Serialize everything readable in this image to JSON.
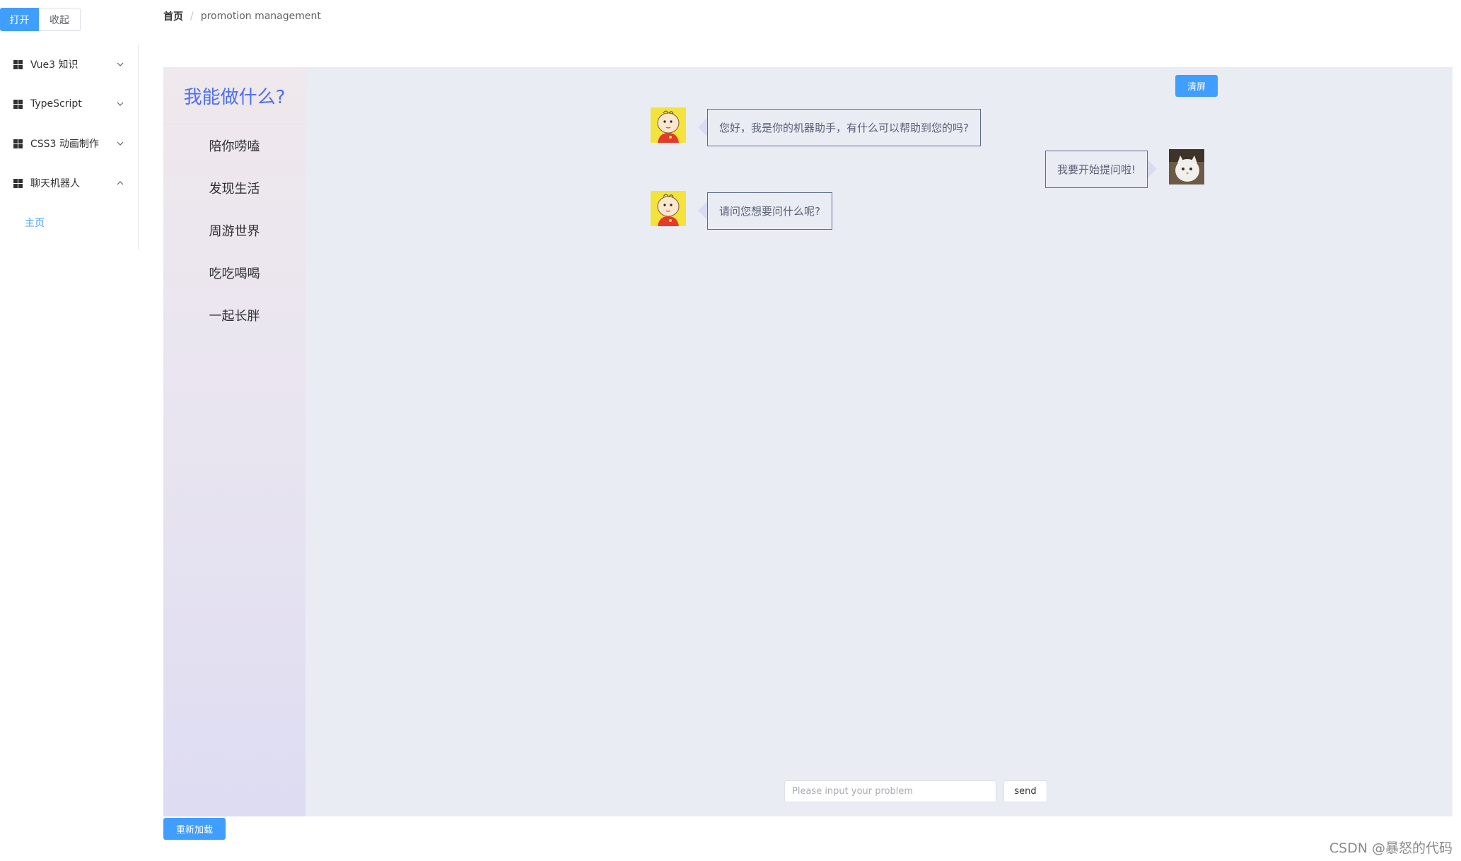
{
  "toggle": {
    "open_label": "打开",
    "collapse_label": "收起"
  },
  "sidebar": {
    "items": [
      {
        "label": "Vue3 知识"
      },
      {
        "label": "TypeScript"
      },
      {
        "label": "CSS3 动画制作"
      },
      {
        "label": "聊天机器人"
      }
    ],
    "sub_item": "主页"
  },
  "breadcrumb": {
    "home": "首页",
    "separator": "/",
    "current": "promotion management"
  },
  "menu": {
    "title": "我能做什么?",
    "items": [
      "陪你唠嗑",
      "发现生活",
      "周游世界",
      "吃吃喝喝",
      "一起长胖"
    ]
  },
  "chat": {
    "clear_label": "清屏",
    "messages": [
      {
        "from": "bot",
        "text": "您好，我是你的机器助手，有什么可以帮助到您的吗?"
      },
      {
        "from": "user",
        "text": "我要开始提问啦!"
      },
      {
        "from": "bot",
        "text": "请问您想要问什么呢?"
      }
    ],
    "input_placeholder": "Please input your problem",
    "send_label": "send"
  },
  "reload_label": "重新加载",
  "watermark": "CSDN @暴怒的代码",
  "colors": {
    "accent": "#409eff",
    "panel_bg": "#eaecf4",
    "title_blue": "#4e6ef2"
  }
}
